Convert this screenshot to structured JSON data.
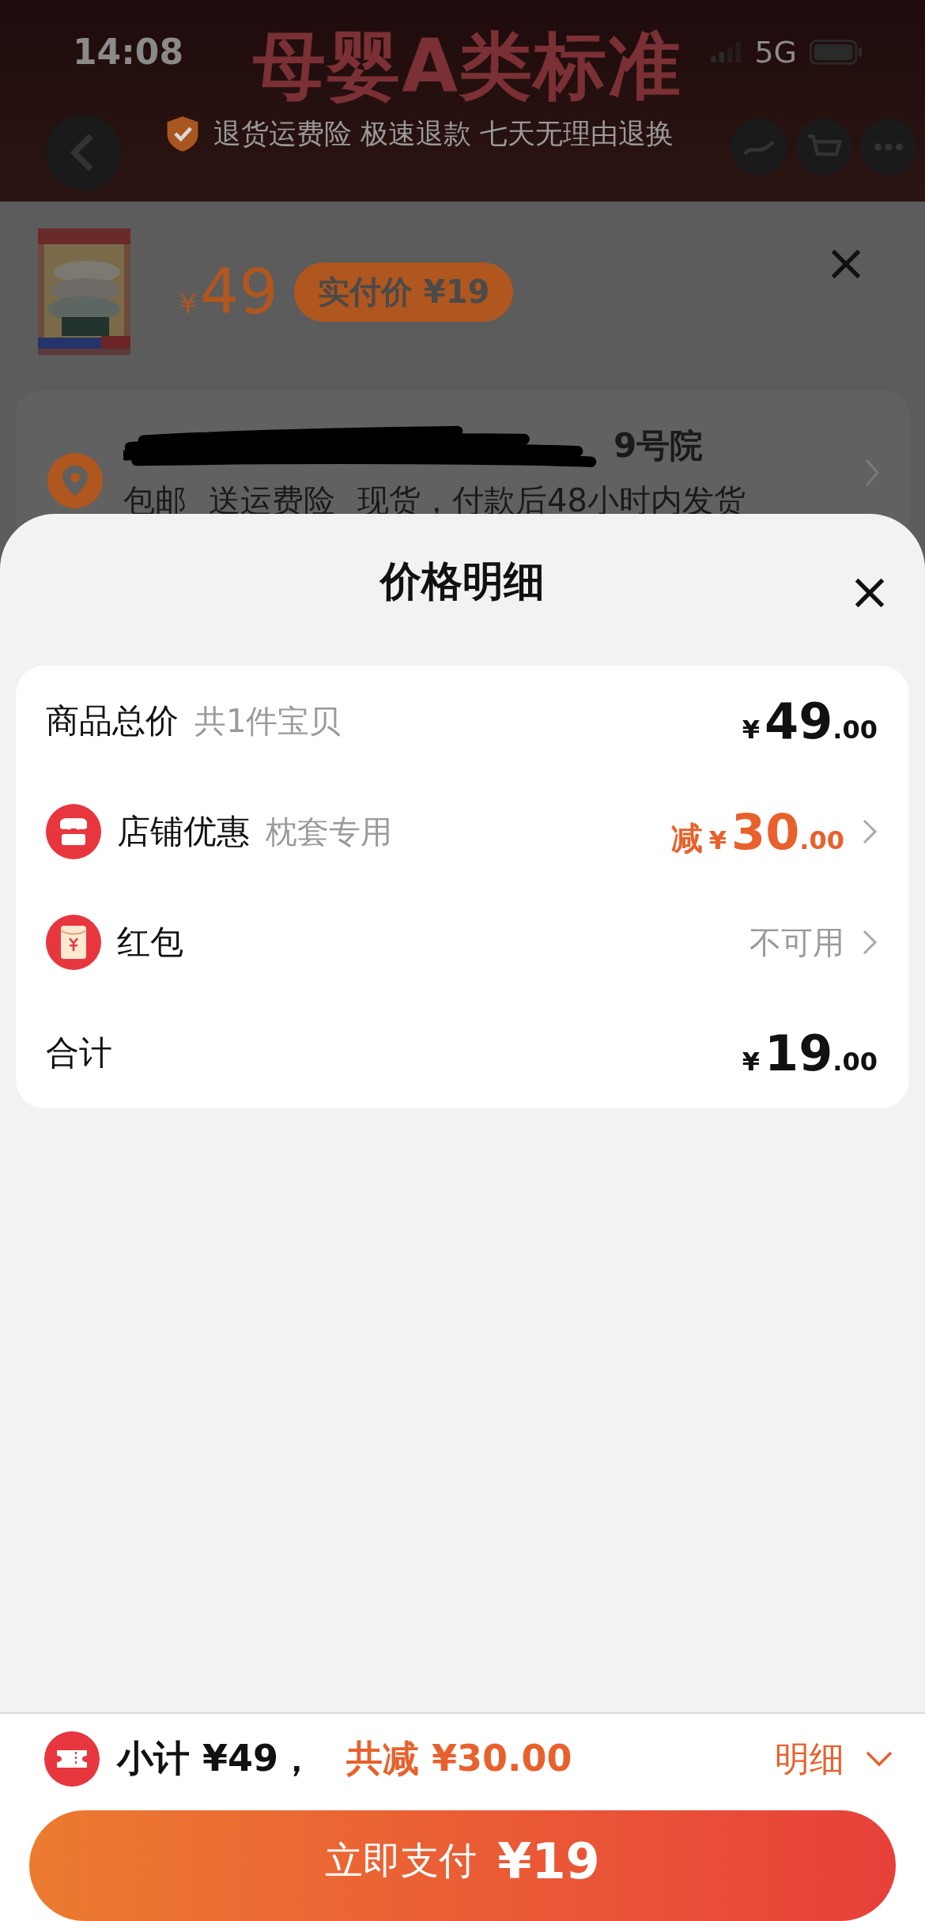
{
  "status_bar": {
    "time": "14:08",
    "network": "5G"
  },
  "background_page": {
    "banner_title": "母婴A类标准",
    "guarantee": "退货运费险 极速退款 七天无理由退换"
  },
  "product_sheet": {
    "currency": "¥",
    "price": "49",
    "paid_badge": "实付价 ¥19",
    "address_tail": "9号院",
    "delivery_notes": [
      "包邮",
      "送运费险",
      "现货，付款后48小时内发货"
    ]
  },
  "price_detail": {
    "title": "价格明细",
    "rows": [
      {
        "kind": "amount",
        "label": "商品总价",
        "note": "共1件宝贝",
        "currency": "¥",
        "integer": "49",
        "decimals": ".00",
        "has_arrow": false
      },
      {
        "kind": "discount",
        "label": "店铺优惠",
        "note": "枕套专用",
        "prefix": "减",
        "currency": "¥",
        "integer": "30",
        "decimals": ".00",
        "has_arrow": true
      },
      {
        "kind": "status",
        "label": "红包",
        "status": "不可用",
        "has_arrow": true
      },
      {
        "kind": "amount",
        "label": "合计",
        "currency": "¥",
        "integer": "19",
        "decimals": ".00",
        "has_arrow": false
      }
    ]
  },
  "bottom_bar": {
    "subtotal": "小计 ¥49，",
    "reduction": "共减 ¥30.00",
    "details_toggle": "明细",
    "expanded": true,
    "pay_label": "立即支付",
    "pay_amount": "¥19"
  }
}
